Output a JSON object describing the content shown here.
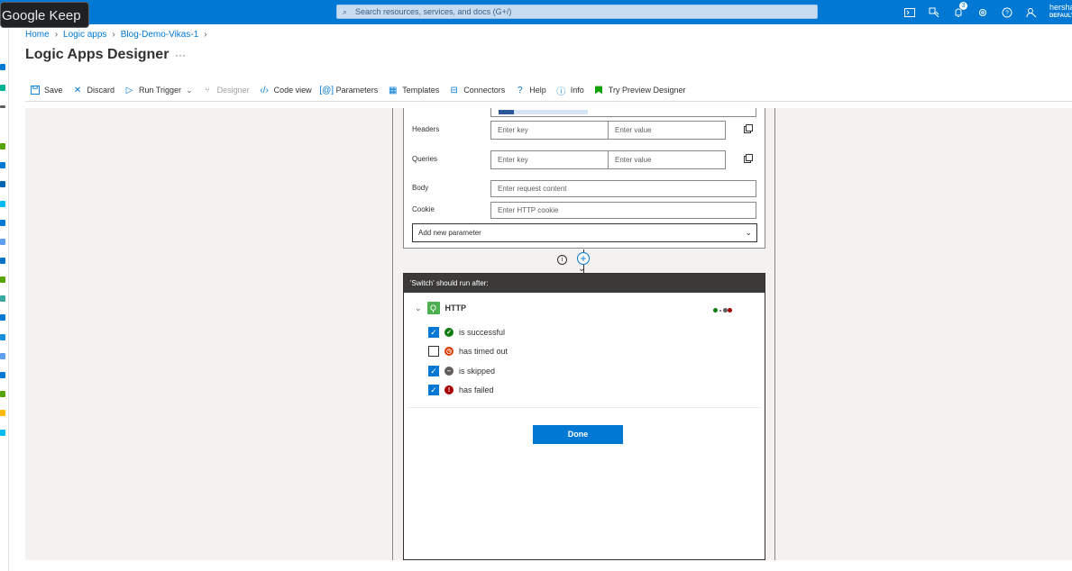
{
  "tooltip": {
    "text": "Google Keep"
  },
  "topbar": {
    "search_placeholder": "Search resources, services, and docs (G+/)",
    "notification_count": "3",
    "account_name": "hersha",
    "account_directory": "DEFAULT",
    "icons": [
      "cloud-shell-icon",
      "directory-filter-icon",
      "notifications-icon",
      "settings-icon",
      "help-icon",
      "feedback-icon"
    ]
  },
  "breadcrumb": {
    "items": [
      "Home",
      "Logic apps",
      "Blog-Demo-Vikas-1"
    ]
  },
  "page": {
    "title": "Logic Apps Designer",
    "more": "···"
  },
  "toolbar": {
    "save": "Save",
    "discard": "Discard",
    "run_trigger": "Run Trigger",
    "designer": "Designer",
    "code_view": "Code view",
    "parameters": "Parameters",
    "templates": "Templates",
    "connectors": "Connectors",
    "help": "Help",
    "info": "Info",
    "try_preview": "Try Preview Designer"
  },
  "http_action": {
    "headers_label": "Headers",
    "queries_label": "Queries",
    "body_label": "Body",
    "cookie_label": "Cookie",
    "key_placeholder": "Enter key",
    "value_placeholder": "Enter value",
    "body_placeholder": "Enter request content",
    "cookie_placeholder": "Enter HTTP cookie",
    "add_parameter": "Add new parameter"
  },
  "run_after": {
    "header": "'Switch' should run after:",
    "action_name": "HTTP",
    "options": [
      {
        "label": "is successful",
        "checked": true,
        "status_color": "#107c10"
      },
      {
        "label": "has timed out",
        "checked": false,
        "status_color": "#d83b01"
      },
      {
        "label": "is skipped",
        "checked": true,
        "status_color": "#605e5c"
      },
      {
        "label": "has failed",
        "checked": true,
        "status_color": "#a80000"
      }
    ],
    "done": "Done"
  },
  "colors": {
    "accent": "#0078d4",
    "topbar": "#0078d4",
    "canvas": "#f3f2f1"
  }
}
